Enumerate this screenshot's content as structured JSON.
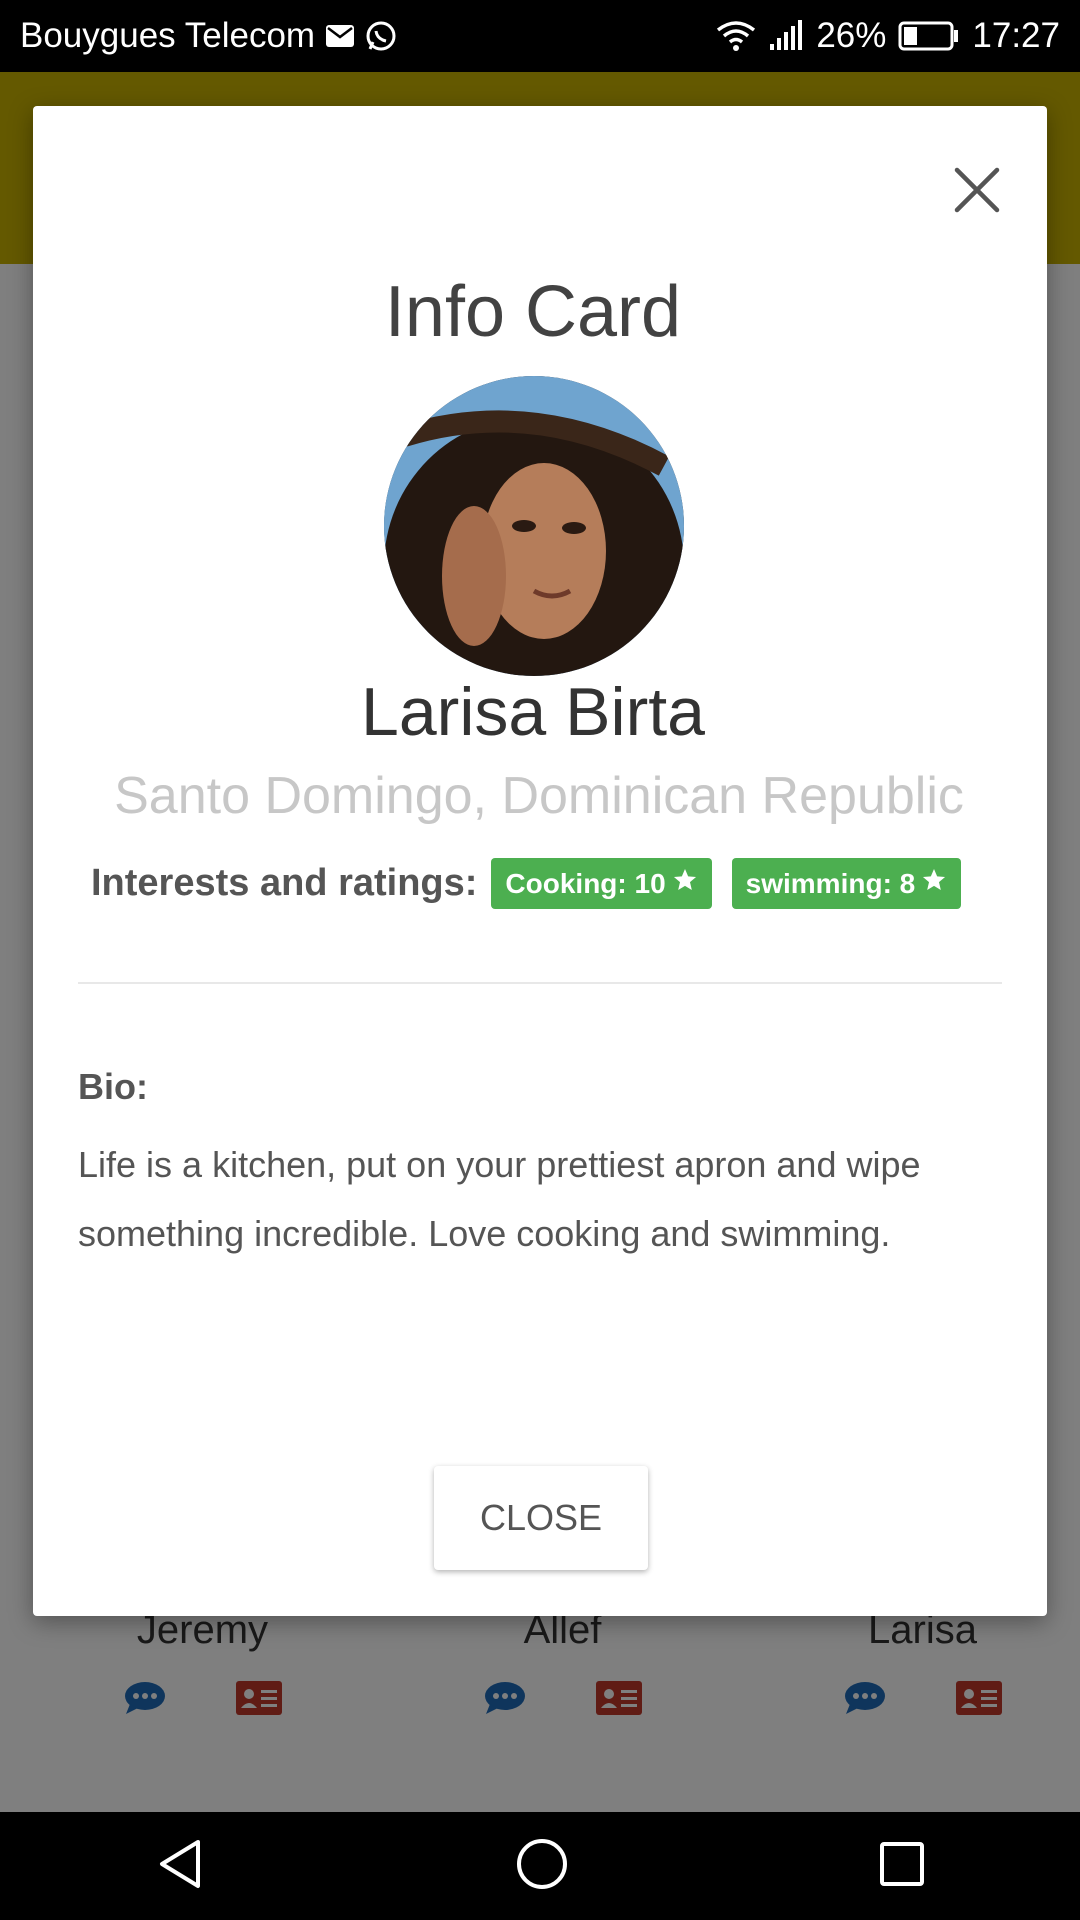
{
  "status_bar": {
    "carrier": "Bouygues Telecom",
    "battery": "26%",
    "time": "17:27"
  },
  "contacts": [
    {
      "name": "Jeremy"
    },
    {
      "name": "Allef"
    },
    {
      "name": "Larisa"
    }
  ],
  "modal": {
    "title": "Info Card",
    "name": "Larisa Birta",
    "location": "Santo Domingo, Dominican Republic",
    "interests_label": "Interests and ratings:",
    "interests": [
      {
        "label": "Cooking: 10"
      },
      {
        "label": "swimming: 8"
      }
    ],
    "bio_label": "Bio:",
    "bio_text": "Life is a kitchen, put on your prettiest apron and wipe something incredible. Love cooking and swimming.",
    "close_button": "CLOSE"
  },
  "colors": {
    "header": "#c9b300",
    "badge": "#4caf50",
    "chat_icon": "#1e6bb8",
    "card_icon": "#c0392b"
  }
}
